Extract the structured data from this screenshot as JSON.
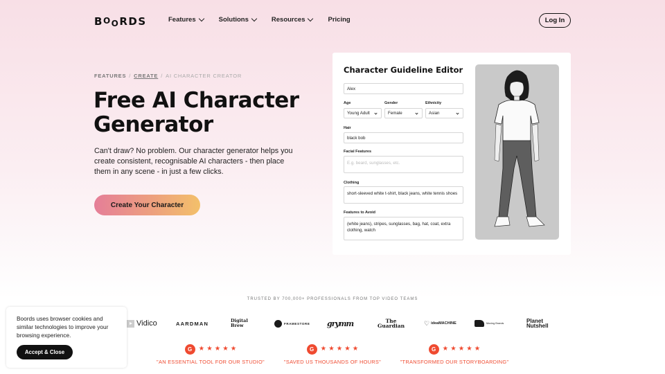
{
  "header": {
    "logo": "BOORDS",
    "nav": [
      {
        "label": "Features",
        "has_dropdown": true
      },
      {
        "label": "Solutions",
        "has_dropdown": true
      },
      {
        "label": "Resources",
        "has_dropdown": true
      },
      {
        "label": "Pricing",
        "has_dropdown": false
      }
    ],
    "login_label": "Log In"
  },
  "hero": {
    "breadcrumb": [
      {
        "label": "FEATURES",
        "link": false
      },
      {
        "label": "CREATE",
        "link": true
      },
      {
        "label": "AI CHARACTER CREATOR",
        "current": true
      }
    ],
    "breadcrumb_sep": "/",
    "title": "Free AI Character Generator",
    "subtitle": "Can't draw? No problem. Our character generator helps you create consistent, recognisable AI characters - then place them in any scene - in just a few clicks.",
    "cta_label": "Create Your Character"
  },
  "editor": {
    "title": "Character Guideline Editor",
    "name_value": "Alex",
    "age_label": "Age",
    "age_value": "Young Adult",
    "gender_label": "Gender",
    "gender_value": "Female",
    "ethnicity_label": "Ethnicity",
    "ethnicity_value": "Asian",
    "hair_label": "Hair",
    "hair_value": "black bob",
    "facial_label": "Facial Features",
    "facial_placeholder": "E.g. beard, sunglasses, etc.",
    "clothing_label": "Clothing",
    "clothing_value": "short-sleeved white t-shirt, black jeans, white tennis shoes",
    "avoid_label": "Features to Avoid",
    "avoid_value": "(white jeans), stripes, sunglasses, bag, hat, coat, extra clothing, watch",
    "preview_alt": "Generated character illustration"
  },
  "trusted": {
    "heading": "TRUSTED BY 700,000+ PROFESSIONALS FROM TOP VIDEO TEAMS",
    "logos": [
      "Vidico",
      "AARDMAN",
      "Digital Brew",
      "FRAMESTORE",
      "GRYMM",
      "The Guardian",
      "ideaMACHINE",
      "Moving Brands",
      "Planet Nutshell"
    ]
  },
  "reviews": [
    {
      "badge": "G",
      "stars": 5,
      "quote": "\"AN ESSENTIAL TOOL FOR OUR STUDIO\""
    },
    {
      "badge": "G",
      "stars": 5,
      "quote": "\"SAVED US THOUSANDS OF HOURS\""
    },
    {
      "badge": "G",
      "stars": 5,
      "quote": "\"TRANSFORMED OUR STORYBOARDING\""
    }
  ],
  "cookie": {
    "text": "Boords uses browser cookies and similar technologies to improve your browsing experience.",
    "button_label": "Accept & Close"
  },
  "colors": {
    "accent": "#ef4a30",
    "cta_gradient_start": "#e57e98",
    "cta_gradient_end": "#f3c06a",
    "bg_top": "#f8dfe6"
  }
}
